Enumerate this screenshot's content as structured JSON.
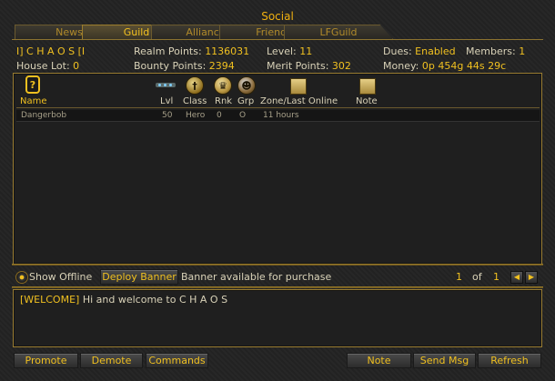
{
  "window": {
    "title": "Social"
  },
  "tabs": [
    {
      "label": "News",
      "active": false
    },
    {
      "label": "Guild",
      "active": true
    },
    {
      "label": "Alliance",
      "active": false
    },
    {
      "label": "Friends",
      "active": false
    },
    {
      "label": "LFGuild",
      "active": false
    }
  ],
  "guild_info": {
    "name": "I] C H A O S [I",
    "house_lot_label": "House Lot:",
    "house_lot": "0",
    "realm_points_label": "Realm Points:",
    "realm_points": "1136031",
    "bounty_points_label": "Bounty Points:",
    "bounty_points": "2394",
    "level_label": "Level:",
    "level": "11",
    "merit_points_label": "Merit Points:",
    "merit_points": "302",
    "dues_label": "Dues:",
    "dues": "Enabled",
    "money_label": "Money:",
    "money": "0p 454g 44s 29c",
    "members_label": "Members:",
    "members": "1"
  },
  "columns": {
    "name": "Name",
    "level": "Lvl",
    "class": "Class",
    "rank": "Rnk",
    "group": "Grp",
    "zone": "Zone/Last Online",
    "note": "Note"
  },
  "members": [
    {
      "name": "Dangerbob",
      "level": "50",
      "class": "Hero",
      "rank": "0",
      "group": "O",
      "zone": "11 hours",
      "note": ""
    }
  ],
  "controls": {
    "show_offline_label": "Show Offline",
    "deploy_banner_label": "Deploy Banner",
    "banner_status": "Banner available for purchase",
    "page_current": "1",
    "page_of": "of",
    "page_total": "1",
    "prev_icon": "triangle-left",
    "next_icon": "triangle-right"
  },
  "motd": {
    "tag": "[WELCOME]",
    "text": "Hi and welcome to C H A O S"
  },
  "buttons": {
    "promote": "Promote",
    "demote": "Demote",
    "commands": "Commands",
    "note": "Note",
    "send_msg": "Send Msg",
    "refresh": "Refresh"
  },
  "colors": {
    "accent": "#f0c020",
    "border": "#9a7d32",
    "background": "#232323"
  }
}
